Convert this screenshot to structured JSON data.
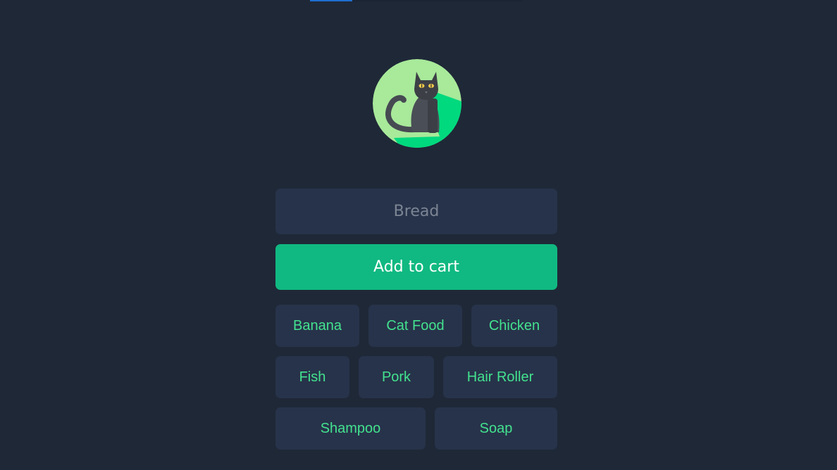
{
  "app": {
    "logo_icon": "black-cat-icon"
  },
  "form": {
    "input_placeholder": "Bread",
    "add_button_label": "Add to cart"
  },
  "items": {
    "row1": [
      {
        "label": "Banana"
      },
      {
        "label": "Cat Food"
      },
      {
        "label": "Chicken"
      }
    ],
    "row2": [
      {
        "label": "Fish"
      },
      {
        "label": "Pork"
      },
      {
        "label": "Hair Roller"
      }
    ],
    "row3": [
      {
        "label": "Shampoo"
      },
      {
        "label": "Soap"
      }
    ]
  },
  "colors": {
    "background": "#1f2837",
    "surface": "#27334a",
    "accent": "#10b981",
    "chip_text": "#43e28f",
    "logo_light": "#a8e99a",
    "logo_dark": "#00d97e"
  }
}
